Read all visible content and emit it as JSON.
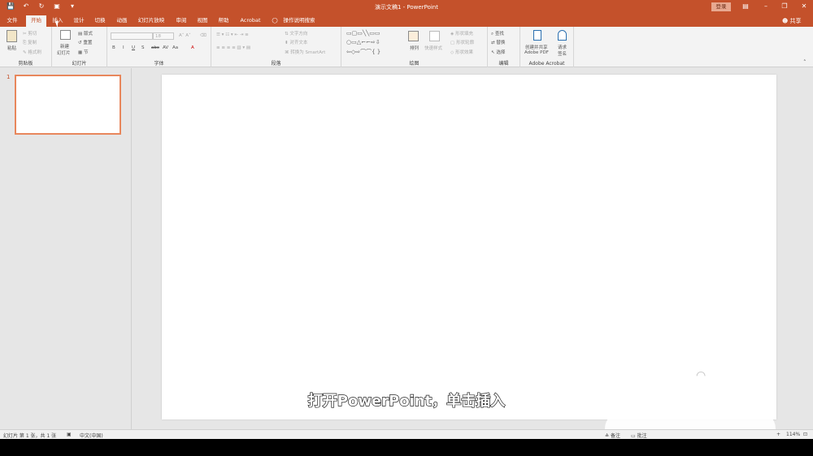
{
  "window": {
    "title": "演示文稿1 - PowerPoint",
    "login": "登录",
    "share": "共享",
    "qat_icons": [
      "save-icon",
      "undo-icon",
      "redo-icon",
      "start-from-beginning-icon",
      "customize-qat-icon"
    ]
  },
  "menu": {
    "tabs": [
      "文件",
      "开始",
      "插入",
      "设计",
      "切换",
      "动画",
      "幻灯片放映",
      "审阅",
      "视图",
      "帮助",
      "Acrobat"
    ],
    "active_tab": "开始",
    "tell_me": "操作说明搜索"
  },
  "ribbon": {
    "clipboard": {
      "label": "剪贴板",
      "paste": "粘贴",
      "cut": "剪切",
      "copy": "复制",
      "format_painter": "格式刷"
    },
    "slides": {
      "label": "幻灯片",
      "new_slide_line1": "新建",
      "new_slide_line2": "幻灯片",
      "layout": "版式",
      "reset": "重置",
      "section": "节"
    },
    "font": {
      "label": "字体",
      "size": "18",
      "bold": "B",
      "italic": "I",
      "underline": "U",
      "shadow": "S",
      "strike": "abc",
      "spacing": "AV",
      "case": "Aa",
      "color": "A"
    },
    "paragraph": {
      "label": "段落",
      "text_direction": "文字方向",
      "align_text": "对齐文本",
      "convert_smartart": "转换为 SmartArt"
    },
    "drawing": {
      "label": "绘图",
      "arrange": "排列",
      "quick_styles": "快速样式",
      "shape_fill": "形状填充",
      "shape_outline": "形状轮廓",
      "shape_effects": "形状效果"
    },
    "editing": {
      "label": "编辑",
      "find": "查找",
      "replace": "替换",
      "select": "选择"
    },
    "acrobat": {
      "label": "Adobe Acrobat",
      "create_line1": "创建并共享",
      "create_line2": "Adobe PDF",
      "request_line1": "请求",
      "request_line2": "签名"
    }
  },
  "thumbnails": {
    "slide_number": "1"
  },
  "caption": "打开PowerPoint，单击插入",
  "status": {
    "slide_info": "幻灯片 第 1 张，共 1 张",
    "language": "中文(中国)",
    "notes": "备注",
    "comments": "批注",
    "zoom": "114%"
  },
  "colors": {
    "accent": "#c4512b",
    "slide_bg": "#ffffff",
    "pane_bg": "#e6e6e6"
  }
}
